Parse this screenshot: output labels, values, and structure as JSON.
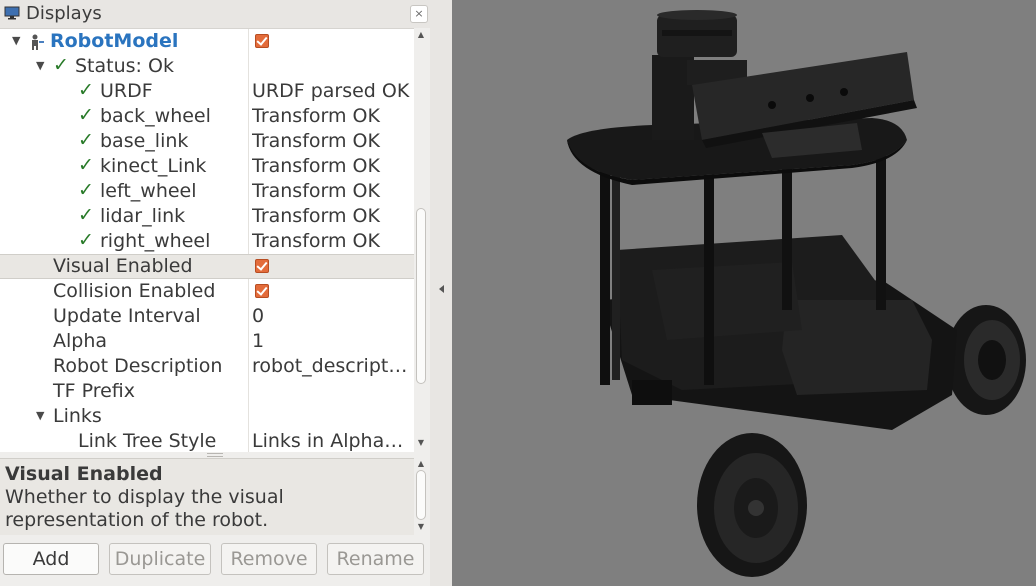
{
  "panel": {
    "title": "Displays",
    "close_glyph": "×",
    "title_icon": "monitor-icon"
  },
  "tree": {
    "robot_model": {
      "label": "RobotModel",
      "checked": true
    },
    "status": {
      "label": "Status: Ok"
    },
    "links_status": [
      {
        "label": "URDF",
        "value": "URDF parsed OK"
      },
      {
        "label": "back_wheel",
        "value": "Transform OK"
      },
      {
        "label": "base_link",
        "value": "Transform OK"
      },
      {
        "label": "kinect_Link",
        "value": "Transform OK"
      },
      {
        "label": "left_wheel",
        "value": "Transform OK"
      },
      {
        "label": "lidar_link",
        "value": "Transform OK"
      },
      {
        "label": "right_wheel",
        "value": "Transform OK"
      }
    ],
    "visual_enabled": {
      "label": "Visual Enabled",
      "checked": true
    },
    "collision_enabled": {
      "label": "Collision Enabled",
      "checked": true
    },
    "update_interval": {
      "label": "Update Interval",
      "value": "0"
    },
    "alpha": {
      "label": "Alpha",
      "value": "1"
    },
    "robot_description": {
      "label": "Robot Description",
      "value": "robot_descript…"
    },
    "tf_prefix": {
      "label": "TF Prefix",
      "value": ""
    },
    "links": {
      "label": "Links"
    },
    "link_tree_style": {
      "label": "Link Tree Style",
      "value": "Links in Alphab…"
    }
  },
  "description": {
    "title": "Visual Enabled",
    "body": "Whether to display the visual representation of the robot."
  },
  "buttons": {
    "add": "Add",
    "duplicate": "Duplicate",
    "remove": "Remove",
    "rename": "Rename"
  },
  "colors": {
    "checkbox": "#e36c3b",
    "check_mark": "#287a28",
    "robot_model_label": "#2a74bf",
    "viewport_bg": "#7f7f7f"
  }
}
